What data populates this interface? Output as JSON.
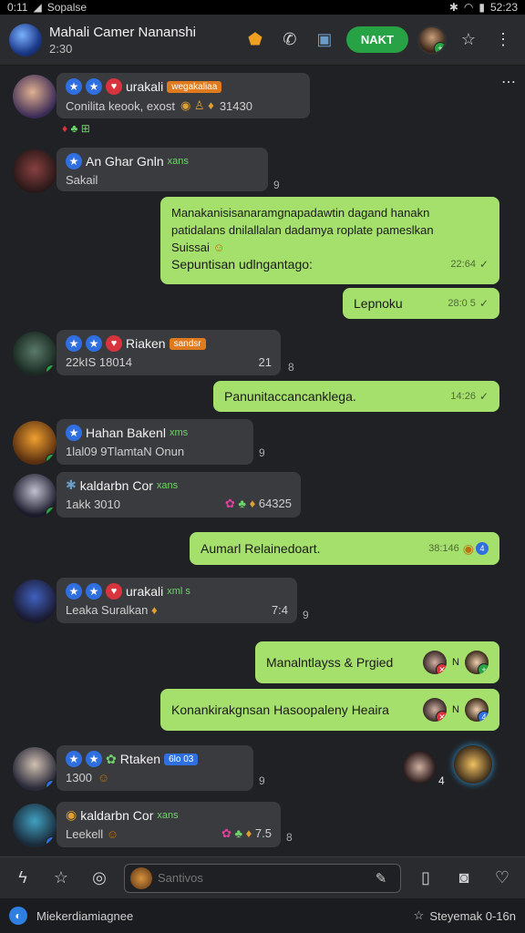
{
  "status": {
    "time": "0:11",
    "app": "Sopalse",
    "right": "52:23"
  },
  "header": {
    "title": "Mahali Camer Nananshi",
    "subtitle": "2:30",
    "next_label": "NAKT"
  },
  "messages": [
    {
      "name": "urakali",
      "tag": "wegakaliaa",
      "text": "Conilita keook, exost",
      "extra": "31430"
    },
    {
      "name": "An Ghar Gnln",
      "tag": "xans",
      "text": "Sakail",
      "meta": "9"
    },
    {
      "text1": "Manakanisisanaramgnapadawtin dagand hanakn",
      "text2": "patidalans dnilallalan dadamya roplate pameslkan",
      "text3": "Suissai",
      "text4": "Sepuntisan udlngantago:",
      "time": "22:64"
    },
    {
      "text": "Lepnoku",
      "time": "28:0 5"
    },
    {
      "name": "Riaken",
      "tag": "sandsr",
      "text": "22kIS 18014",
      "time": "21",
      "meta": "8"
    },
    {
      "text": "Panunitaccancanklega.",
      "time": "14:26"
    },
    {
      "name": "Hahan Bakenl",
      "tag": "xms",
      "text": "1lal09 9TlamtaN Onun",
      "meta": "9"
    },
    {
      "name": "kaldarbn Cor",
      "tag": "xans",
      "text": "1akk 3010",
      "extra": "64325"
    },
    {
      "text": "Aumarl Relainedoart.",
      "time": "38:146"
    },
    {
      "name": "urakali",
      "tag": "xml s",
      "text": "Leaka Suralkan",
      "time": "7:4",
      "meta": "9"
    },
    {
      "text": "Manalntlayss & Prgied",
      "label": "N"
    },
    {
      "text": "Konankirakgnsan Hasoopaleny Heaira",
      "label": "N"
    },
    {
      "name": "Rtaken",
      "tag": "6lo 03",
      "text": "1300",
      "meta": "9",
      "side_label": "4"
    },
    {
      "name": "kaldarbn Cor",
      "tag": "xans",
      "text": "Leekell",
      "extra": "7.5",
      "meta": "8"
    }
  ],
  "input": {
    "placeholder": "Santivos"
  },
  "bottom": {
    "left": "Miekerdiamiagnee",
    "right": "Steyemak 0-16n"
  }
}
